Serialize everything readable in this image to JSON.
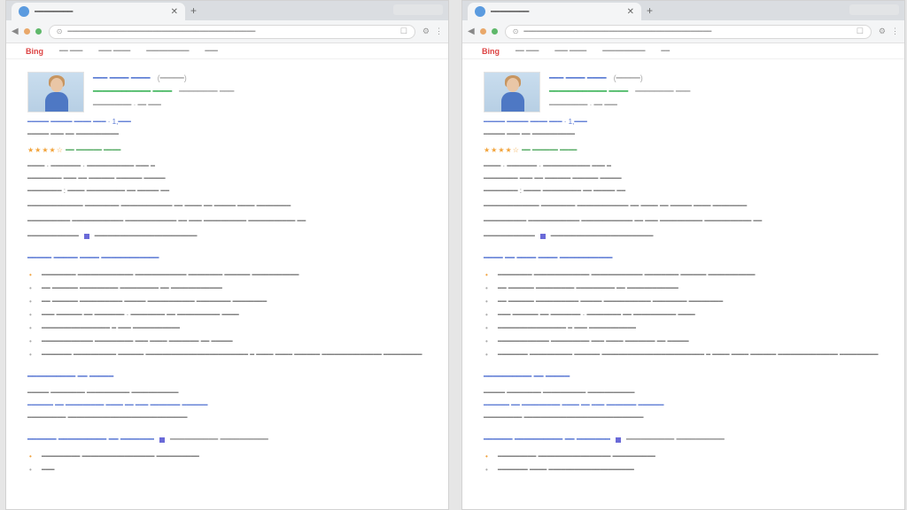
{
  "windows": [
    {
      "tab_title": "━━━━━━━━",
      "address": "━━━━━━━━━━━━━━━━━━━━━━━━━━━━━━━━━━━━━━━━━━━━",
      "site_logo": "Bing",
      "site_nav": [
        "━━ ━━━",
        "━━━ ━━━━",
        "━━━━━━━━━━",
        "━━━"
      ],
      "profile": {
        "name": "━━━ ━━━━ ━━━━",
        "name_note": "(━━━━━)",
        "title": "━━━━━━━━━━━━ ━━━━",
        "title_note": "━━━━━━━━ ━━━",
        "line1": "━━━━━━━━━ · ━━ ━━━",
        "line2": "━━━━━ ━━━━━ ━━━━ ━━━ · 1,━━━",
        "line3": "━━━━━ ━━━ ━━ ━━━━━━━━━━"
      },
      "rating_stars": "★★★★☆",
      "rating_text": "━━ ━━━━━━ ━━━━",
      "facts": [
        "━━━━ · ━━━━━━━ · ━━━━━━━━━━━ ━━━ ━",
        "━━━━━━━━ ━━━ ━━ ━━━━━━ ━━━━━━ ━━━━━",
        "━━━━━━━━ : ━━━━ ━━━━━━━━━ ━━ ━━━━━ ━━"
      ],
      "desc_1": "━━━━━━━━━━━━━ ━━━━━━━━ ━━━━━━━━━━━━ ━━ ━━━━ ━━ ━━━━━ ━━━━ ━━━━━━━━",
      "desc_2": "━━━━━━━━━━ ━━━━━━━━━━━━ ━━━━━━━━━━━━ ━━ ━━━ ━━━━━━━━━━ ━━━━━━━━━━━ ━━",
      "desc_3a": "━━━━━━━━━━━━",
      "desc_3b": "━━━━━━━━━━━━━━━━━━━━━━━━",
      "section1": {
        "heading": "━━━━━ ━━━━━ ━━━━ ━━━━━━━━━━━━",
        "items": [
          "━━━━━━━━ ━━━━━━━━━━━━━ ━━━━━━━━━━━━ ━━━━━━━━ ━━━━━━ ━━━━━━━━━━━",
          "━━ ━━━━━━ ━━━━━━━━━ ━━━━━━━━━ ━━ ━━━━━━━━━━━━",
          "━━ ━━━━━━ ━━━━━━━━━━ ━━━━━ ━━━━━━━━━━━ ━━━━━━━━ ━━━━━━━━",
          "━━━ ━━━━━━ ━━ ━━━━━━━ · ━━━━━━━━ ━━ ━━━━━━━━━━ ━━━━",
          "━━━━━━━━━━━━━━━━ ━ ━━━ ━━━━━━━━━━━",
          "━━━━━━━━━━━━ ━━━━━━━━━ ━━━ ━━━━ ━━━━━━━ ━━ ━━━━━",
          "━━━━━━━ ━━━━━━━━━━ ━━━━━━ ━━━━━━━━━━━━━━━━━━━━━━━━ ━ ━━━━ ━━━━ ━━━━━━ ━━━━━━━━━━━━━━ ━━━━━━━━━"
        ]
      },
      "section2": {
        "heading": "━━━━━━━━━━ ━━ ━━━━━",
        "l1": "━━━━━ ━━━━━━━━ ━━━━━━━━━━ ━━━━━━━━━━━",
        "l2": "━━━━━━ ━━ ━━━━━━━━━ ━━━━ ━━ ━━━ ━━━━━━━ ━━━━━━",
        "l3": "━━━━━━━━━ ━━━━━━━━━━━━━━━━━━━━━━━━━━━━"
      },
      "section3": {
        "heading": "━━━━━━ ━━━━━━━━━━ ━━ ━━━━━━━",
        "aside": "━━━━━━━━━━ ━━━━━━━━━━",
        "items": [
          "━━━━━━━━━ ━━━━━━━━━━━━━━━━━ ━━━━━━━━━━",
          "━━━"
        ]
      }
    },
    {
      "tab_title": "━━━━━━━━",
      "address": "━━━━━━━━━━━━━━━━━━━━━━━━━━━━━━━━━━━━━━━━━━━━",
      "site_logo": "Bing",
      "site_nav": [
        "━━ ━━━",
        "━━━ ━━━━",
        "━━━━━━━━━━",
        "━━"
      ],
      "profile": {
        "name": "━━━ ━━━━ ━━━━",
        "name_note": "(━━━━━)",
        "title": "━━━━━━━━━━━━ ━━━━",
        "title_note": "━━━━━━━━ ━━━",
        "line1": "━━━━━━━━━ · ━━ ━━━",
        "line2": "━━━━━ ━━━━━ ━━━━ ━━━ · 1,━━━",
        "line3": "━━━━━ ━━━ ━━ ━━━━━━━━━━"
      },
      "rating_stars": "★★★★☆",
      "rating_text": "━━ ━━━━━━ ━━━━",
      "facts": [
        "━━━━ · ━━━━━━━ · ━━━━━━━━━━━ ━━━ ━",
        "━━━━━━━━ ━━━ ━━ ━━━━━━ ━━━━━━ ━━━━━",
        "━━━━━━━━ : ━━━━ ━━━━━━━━━ ━━ ━━━━━ ━━"
      ],
      "desc_1": "━━━━━━━━━━━━━ ━━━━━━━━ ━━━━━━━━━━━━ ━━ ━━━━ ━━ ━━━━━ ━━━━ ━━━━━━━━",
      "desc_2": "━━━━━━━━━━ ━━━━━━━━━━━━ ━━━━━━━━━━━━ ━━ ━━━ ━━━━━━━━━━ ━━━━━━━━━━━ ━━",
      "desc_3a": "━━━━━━━━━━━━",
      "desc_3b": "━━━━━━━━━━━━━━━━━━━━━━━━",
      "section1": {
        "heading": "━━━━ ━━ ━━━━ ━━━━ ━━━━━━━━━━━",
        "items": [
          "━━━━━━━━ ━━━━━━━━━━━━━ ━━━━━━━━━━━━ ━━━━━━━━ ━━━━━━ ━━━━━━━━━━━",
          "━━ ━━━━━━ ━━━━━━━━━ ━━━━━━━━━ ━━ ━━━━━━━━━━━━",
          "━━ ━━━━━━ ━━━━━━━━━━ ━━━━━ ━━━━━━━━━━━ ━━━━━━━━ ━━━━━━━━",
          "━━━ ━━━━━━ ━━ ━━━━━━━ · ━━━━━━━━ ━━ ━━━━━━━━━━ ━━━━",
          "━━━━━━━━━━━━━━━━ ━ ━━━ ━━━━━━━━━━━",
          "━━━━━━━━━━━━ ━━━━━━━━━ ━━━ ━━━━ ━━━━━━━ ━━ ━━━━━",
          "━━━━━━━ ━━━━━━━━━━ ━━━━━━ ━━━━━━━━━━━━━━━━━━━━━━━━ ━ ━━━━ ━━━━ ━━━━━━ ━━━━━━━━━━━━━━ ━━━━━━━━━"
        ]
      },
      "section2": {
        "heading": "━━━━━━━━━━ ━━ ━━━━━",
        "l1": "━━━━━ ━━━━━━━━ ━━━━━━━━━━ ━━━━━━━━━━━",
        "l2": "━━━━━━ ━━ ━━━━━━━━━ ━━━━ ━━ ━━━ ━━━━━━━ ━━━━━━",
        "l3": "━━━━━━━━━ ━━━━━━━━━━━━━━━━━━━━━━━━━━━━"
      },
      "section3": {
        "heading": "━━━━━━ ━━━━━━━━━━ ━━ ━━━━━━━",
        "aside": "━━━━━━━━━━ ━━━━━━━━━━",
        "items": [
          "━━━━━━━━━ ━━━━━━━━━━━━━━━━━ ━━━━━━━━━━",
          "━━━━━━━ ━━━━ ━━━━━━━━━━━━━━━━━━━━"
        ]
      }
    }
  ],
  "colors": {
    "link": "#5b79d4",
    "green": "#2eae4d",
    "star": "#f2a33a",
    "logo": "#dd4444"
  }
}
